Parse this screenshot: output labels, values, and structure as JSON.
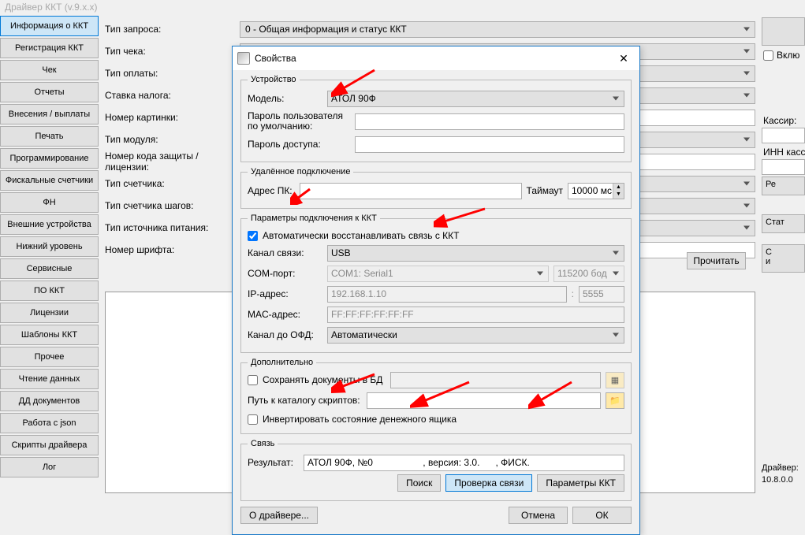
{
  "main_title": "Драйвер ККТ (v.9.x.x)",
  "sidebar": {
    "items": [
      "Информация о ККТ",
      "Регистрация ККТ",
      "Чек",
      "Отчеты",
      "Внесения / выплаты",
      "Печать",
      "Программирование",
      "Фискальные счетчики",
      "ФН",
      "Внешние устройства",
      "Нижний уровень",
      "Сервисные",
      "ПО ККТ",
      "Лицензии",
      "Шаблоны ККТ",
      "Прочее",
      "Чтение данных",
      "ДД документов",
      "Работа с json",
      "Скрипты драйвера",
      "Лог"
    ],
    "active_index": 0
  },
  "form_labels": {
    "tip_zaprosa": "Тип запроса:",
    "tip_cheka": "Тип чека:",
    "tip_oplaty": "Тип оплаты:",
    "stavka_naloga": "Ставка налога:",
    "nomer_kartinki": "Номер картинки:",
    "tip_modulya": "Тип модуля:",
    "nomer_koda": "Номер кода защиты / лицензии:",
    "tip_schetchika": "Тип счетчика:",
    "tip_shagov": "Тип счетчика шагов:",
    "tip_pitaniya": "Тип источника питания:",
    "nomer_shrifta": "Номер шрифта:"
  },
  "request_type_value": "0 - Общая информация и статус ККТ",
  "read_button": "Прочитать",
  "right": {
    "enable_label": "Вклю",
    "cashier_label": "Кассир:",
    "inn_label": "ИНН касси",
    "btn_reg": "Ре",
    "btn_stat": "Стат",
    "btn_ofd": "С\nи",
    "driver_label": "Драйвер:",
    "driver_ver": "10.8.0.0"
  },
  "dialog": {
    "title": "Свойства",
    "groups": {
      "device": "Устройство",
      "remote": "Удалённое подключение",
      "conn": "Параметры подключения к ККТ",
      "extra": "Дополнительно",
      "link": "Связь"
    },
    "labels": {
      "model": "Модель:",
      "user_pwd": "Пароль пользователя по умолчанию:",
      "access_pwd": "Пароль доступа:",
      "pc_addr": "Адрес ПК:",
      "timeout": "Таймаут",
      "auto_restore": "Автоматически восстанавливать связь с ККТ",
      "channel": "Канал связи:",
      "com_port": "COM-порт:",
      "ip_addr": "IP-адрес:",
      "mac_addr": "MAC-адрес:",
      "ofd_channel": "Канал до ОФД:",
      "save_docs": "Сохранять документы в БД",
      "script_path": "Путь к каталогу скриптов:",
      "invert_drawer": "Инвертировать состояние денежного ящика",
      "result": "Результат:"
    },
    "values": {
      "model": "АТОЛ 90Ф",
      "timeout": "10000 мс.",
      "channel": "USB",
      "com_port": "COM1: Serial1",
      "com_baud": "115200 бод",
      "ip_addr": "192.168.1.10",
      "ip_port": "5555",
      "mac_addr": "FF:FF:FF:FF:FF:FF",
      "ofd_channel": "Автоматически",
      "result": "АТОЛ 90Ф, №0                   , версия: 3.0.      , ФИСК."
    },
    "buttons": {
      "about": "О драйвере...",
      "search": "Поиск",
      "check": "Проверка связи",
      "params": "Параметры ККТ",
      "cancel": "Отмена",
      "ok": "ОК"
    }
  }
}
